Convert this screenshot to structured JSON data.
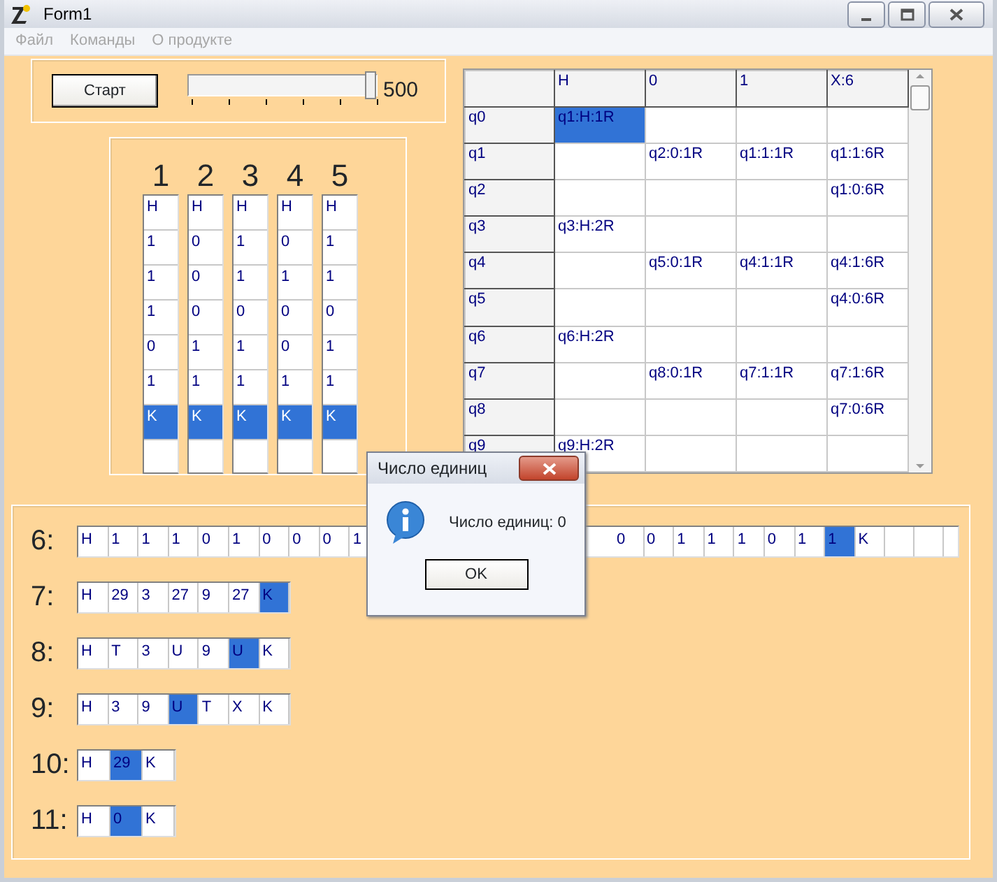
{
  "window": {
    "title": "Form1"
  },
  "menu": [
    {
      "label": "Файл",
      "disabled": true
    },
    {
      "label": "Команды",
      "disabled": true
    },
    {
      "label": "О продукте",
      "disabled": true
    }
  ],
  "start_button": "Старт",
  "slider": {
    "level": 1,
    "reading": "500"
  },
  "tapes": {
    "headings": [
      "1",
      "2",
      "3",
      "4",
      "5"
    ],
    "columns": [
      [
        {
          "v": "H",
          "selected": false
        },
        {
          "v": "1",
          "selected": false
        },
        {
          "v": "1",
          "selected": false
        },
        {
          "v": "1",
          "selected": false
        },
        {
          "v": "0",
          "selected": false
        },
        {
          "v": "1",
          "selected": false
        },
        {
          "v": "K",
          "selected": true
        }
      ],
      [
        {
          "v": "H",
          "selected": false
        },
        {
          "v": "0",
          "selected": false
        },
        {
          "v": "0",
          "selected": false
        },
        {
          "v": "0",
          "selected": false
        },
        {
          "v": "1",
          "selected": false
        },
        {
          "v": "1",
          "selected": false
        },
        {
          "v": "K",
          "selected": true
        }
      ],
      [
        {
          "v": "H",
          "selected": false
        },
        {
          "v": "1",
          "selected": false
        },
        {
          "v": "1",
          "selected": false
        },
        {
          "v": "0",
          "selected": false
        },
        {
          "v": "1",
          "selected": false
        },
        {
          "v": "1",
          "selected": false
        },
        {
          "v": "K",
          "selected": true
        }
      ],
      [
        {
          "v": "H",
          "selected": false
        },
        {
          "v": "0",
          "selected": false
        },
        {
          "v": "1",
          "selected": false
        },
        {
          "v": "0",
          "selected": false
        },
        {
          "v": "0",
          "selected": false
        },
        {
          "v": "1",
          "selected": false
        },
        {
          "v": "K",
          "selected": true
        }
      ],
      [
        {
          "v": "H",
          "selected": false
        },
        {
          "v": "1",
          "selected": false
        },
        {
          "v": "1",
          "selected": false
        },
        {
          "v": "0",
          "selected": false
        },
        {
          "v": "1",
          "selected": false
        },
        {
          "v": "1",
          "selected": false
        },
        {
          "v": "K",
          "selected": true
        }
      ]
    ]
  },
  "table": {
    "columns": [
      "H",
      "0",
      "1",
      "X:6"
    ],
    "rows": [
      {
        "state": "q0",
        "cells": [
          {
            "text": "q1:H:1R",
            "selected": true
          },
          null,
          null,
          null
        ]
      },
      {
        "state": "q1",
        "cells": [
          null,
          {
            "text": "q2:0:1R",
            "selected": false
          },
          {
            "text": "q1:1:1R",
            "selected": false
          },
          {
            "text": "q1:1:6R",
            "selected": false
          }
        ]
      },
      {
        "state": "q2",
        "cells": [
          null,
          null,
          null,
          {
            "text": "q1:0:6R",
            "selected": false
          }
        ]
      },
      {
        "state": "q3",
        "cells": [
          {
            "text": "q3:H:2R",
            "selected": false
          },
          null,
          null,
          null
        ]
      },
      {
        "state": "q4",
        "cells": [
          null,
          {
            "text": "q5:0:1R",
            "selected": false
          },
          {
            "text": "q4:1:1R",
            "selected": false
          },
          {
            "text": "q4:1:6R",
            "selected": false
          }
        ]
      },
      {
        "state": "q5",
        "cells": [
          null,
          null,
          null,
          {
            "text": "q4:0:6R",
            "selected": false
          }
        ]
      },
      {
        "state": "q6",
        "cells": [
          {
            "text": "q6:H:2R",
            "selected": false
          },
          null,
          null,
          null
        ]
      },
      {
        "state": "q7",
        "cells": [
          null,
          {
            "text": "q8:0:1R",
            "selected": false
          },
          {
            "text": "q7:1:1R",
            "selected": false
          },
          {
            "text": "q7:1:6R",
            "selected": false
          }
        ]
      },
      {
        "state": "q8",
        "cells": [
          null,
          null,
          null,
          {
            "text": "q7:0:6R",
            "selected": false
          }
        ]
      },
      {
        "state": "q9",
        "cells": [
          {
            "text": "q9:H:2R",
            "selected": false
          },
          null,
          null,
          null
        ]
      }
    ]
  },
  "results": [
    {
      "label": "6:",
      "cells": [
        {
          "v": "H",
          "selected": false
        },
        {
          "v": "1",
          "selected": false
        },
        {
          "v": "1",
          "selected": false
        },
        {
          "v": "1",
          "selected": false
        },
        {
          "v": "0",
          "selected": false
        },
        {
          "v": "1",
          "selected": false
        },
        {
          "v": "0",
          "selected": false
        },
        {
          "v": "0",
          "selected": false
        },
        {
          "v": "0",
          "selected": false
        },
        {
          "v": "1",
          "selected": false
        }
      ],
      "cells_after_dialog": [
        {
          "v": "0",
          "selected": false
        },
        {
          "v": "0",
          "selected": false
        },
        {
          "v": "1",
          "selected": false
        },
        {
          "v": "1",
          "selected": false
        },
        {
          "v": "1",
          "selected": false
        },
        {
          "v": "0",
          "selected": false
        },
        {
          "v": "1",
          "selected": false
        },
        {
          "v": "1",
          "selected": true
        },
        {
          "v": "K",
          "selected": false
        }
      ]
    },
    {
      "label": "7:",
      "cells": [
        {
          "v": "H",
          "selected": false
        },
        {
          "v": "29",
          "selected": false
        },
        {
          "v": "3",
          "selected": false
        },
        {
          "v": "27",
          "selected": false
        },
        {
          "v": "9",
          "selected": false
        },
        {
          "v": "27",
          "selected": false
        },
        {
          "v": "K",
          "selected": true
        }
      ]
    },
    {
      "label": "8:",
      "cells": [
        {
          "v": "H",
          "selected": false
        },
        {
          "v": "T",
          "selected": false
        },
        {
          "v": "3",
          "selected": false
        },
        {
          "v": "U",
          "selected": false
        },
        {
          "v": "9",
          "selected": false
        },
        {
          "v": "U",
          "selected": true
        },
        {
          "v": "K",
          "selected": false
        }
      ]
    },
    {
      "label": "9:",
      "cells": [
        {
          "v": "H",
          "selected": false
        },
        {
          "v": "3",
          "selected": false
        },
        {
          "v": "9",
          "selected": false
        },
        {
          "v": "U",
          "selected": true
        },
        {
          "v": "T",
          "selected": false
        },
        {
          "v": "X",
          "selected": false
        },
        {
          "v": "K",
          "selected": false
        }
      ]
    },
    {
      "label": "10:",
      "cells": [
        {
          "v": "H",
          "selected": false
        },
        {
          "v": "29",
          "selected": true
        },
        {
          "v": "K",
          "selected": false
        }
      ]
    },
    {
      "label": "11:",
      "cells": [
        {
          "v": "H",
          "selected": false
        },
        {
          "v": "0",
          "selected": true
        },
        {
          "v": "K",
          "selected": false
        }
      ]
    }
  ],
  "dialog": {
    "title": "Число единиц",
    "message": "Число единиц: 0",
    "button": "OK"
  }
}
